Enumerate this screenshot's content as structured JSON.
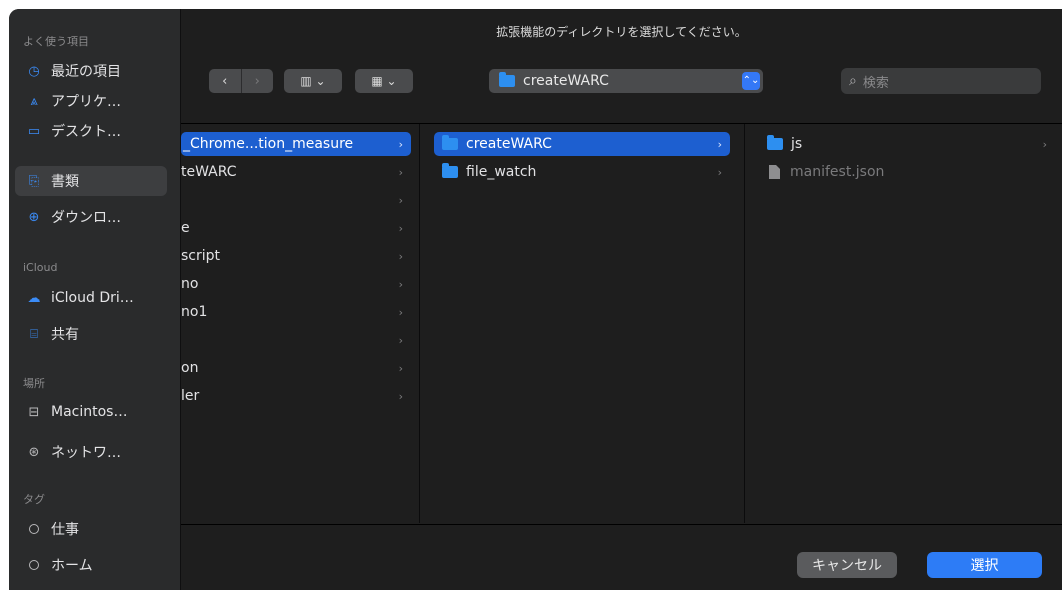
{
  "dialog": {
    "title": "拡張機能のディレクトリを選択してください。"
  },
  "sidebar": {
    "sections": [
      {
        "label": "よく使う項目"
      },
      {
        "label": "iCloud"
      },
      {
        "label": "場所"
      },
      {
        "label": "タグ"
      }
    ],
    "items": [
      {
        "label": "最近の項目",
        "icon": "clock-icon",
        "glyph": "◷"
      },
      {
        "label": "アプリケ…",
        "icon": "applications-icon",
        "glyph": "⩓"
      },
      {
        "label": "デスクト…",
        "icon": "desktop-icon",
        "glyph": "▭"
      },
      {
        "label": "書類",
        "icon": "document-icon",
        "glyph": "⎘"
      },
      {
        "label": "ダウンロ…",
        "icon": "download-icon",
        "glyph": "⊕"
      },
      {
        "label": "iCloud Dri…",
        "icon": "cloud-icon",
        "glyph": "☁"
      },
      {
        "label": "共有",
        "icon": "shared-folder-icon",
        "glyph": "⌸"
      },
      {
        "label": "Macintos…",
        "icon": "disk-icon",
        "glyph": "⊟"
      },
      {
        "label": "ネットワ…",
        "icon": "network-icon",
        "glyph": "⊛"
      },
      {
        "label": "仕事",
        "icon": "tag-icon"
      },
      {
        "label": "ホーム",
        "icon": "tag-icon"
      }
    ]
  },
  "toolbar": {
    "back_glyph": "‹",
    "forward_glyph": "›",
    "column_view_glyph": "▥ ⌄",
    "group_glyph": "▦ ⌄",
    "path_folder": "createWARC",
    "path_arrows": "⌃⌄",
    "search_placeholder": "検索",
    "search_glyph": "⌕"
  },
  "columns": {
    "col1": [
      {
        "label": "_Chrome...tion_measure",
        "selected": true
      },
      {
        "label": "teWARC"
      },
      {
        "label": ""
      },
      {
        "label": "e"
      },
      {
        "label": "script"
      },
      {
        "label": "no"
      },
      {
        "label": "no1"
      },
      {
        "label": ""
      },
      {
        "label": "on"
      },
      {
        "label": "ler"
      }
    ],
    "col2": [
      {
        "label": "createWARC",
        "selected": true
      },
      {
        "label": "file_watch"
      }
    ],
    "col3": [
      {
        "label": "js",
        "type": "folder"
      },
      {
        "label": "manifest.json",
        "type": "file"
      }
    ],
    "chevron": "›"
  },
  "buttons": {
    "cancel": "キャンセル",
    "select": "選択"
  },
  "colors": {
    "accent": "#2d7cf6",
    "selection": "#1d5fd0",
    "folder": "#2d8ff0",
    "sidebar_bg": "#2a2b2c",
    "window_bg": "#1e1e1e"
  }
}
